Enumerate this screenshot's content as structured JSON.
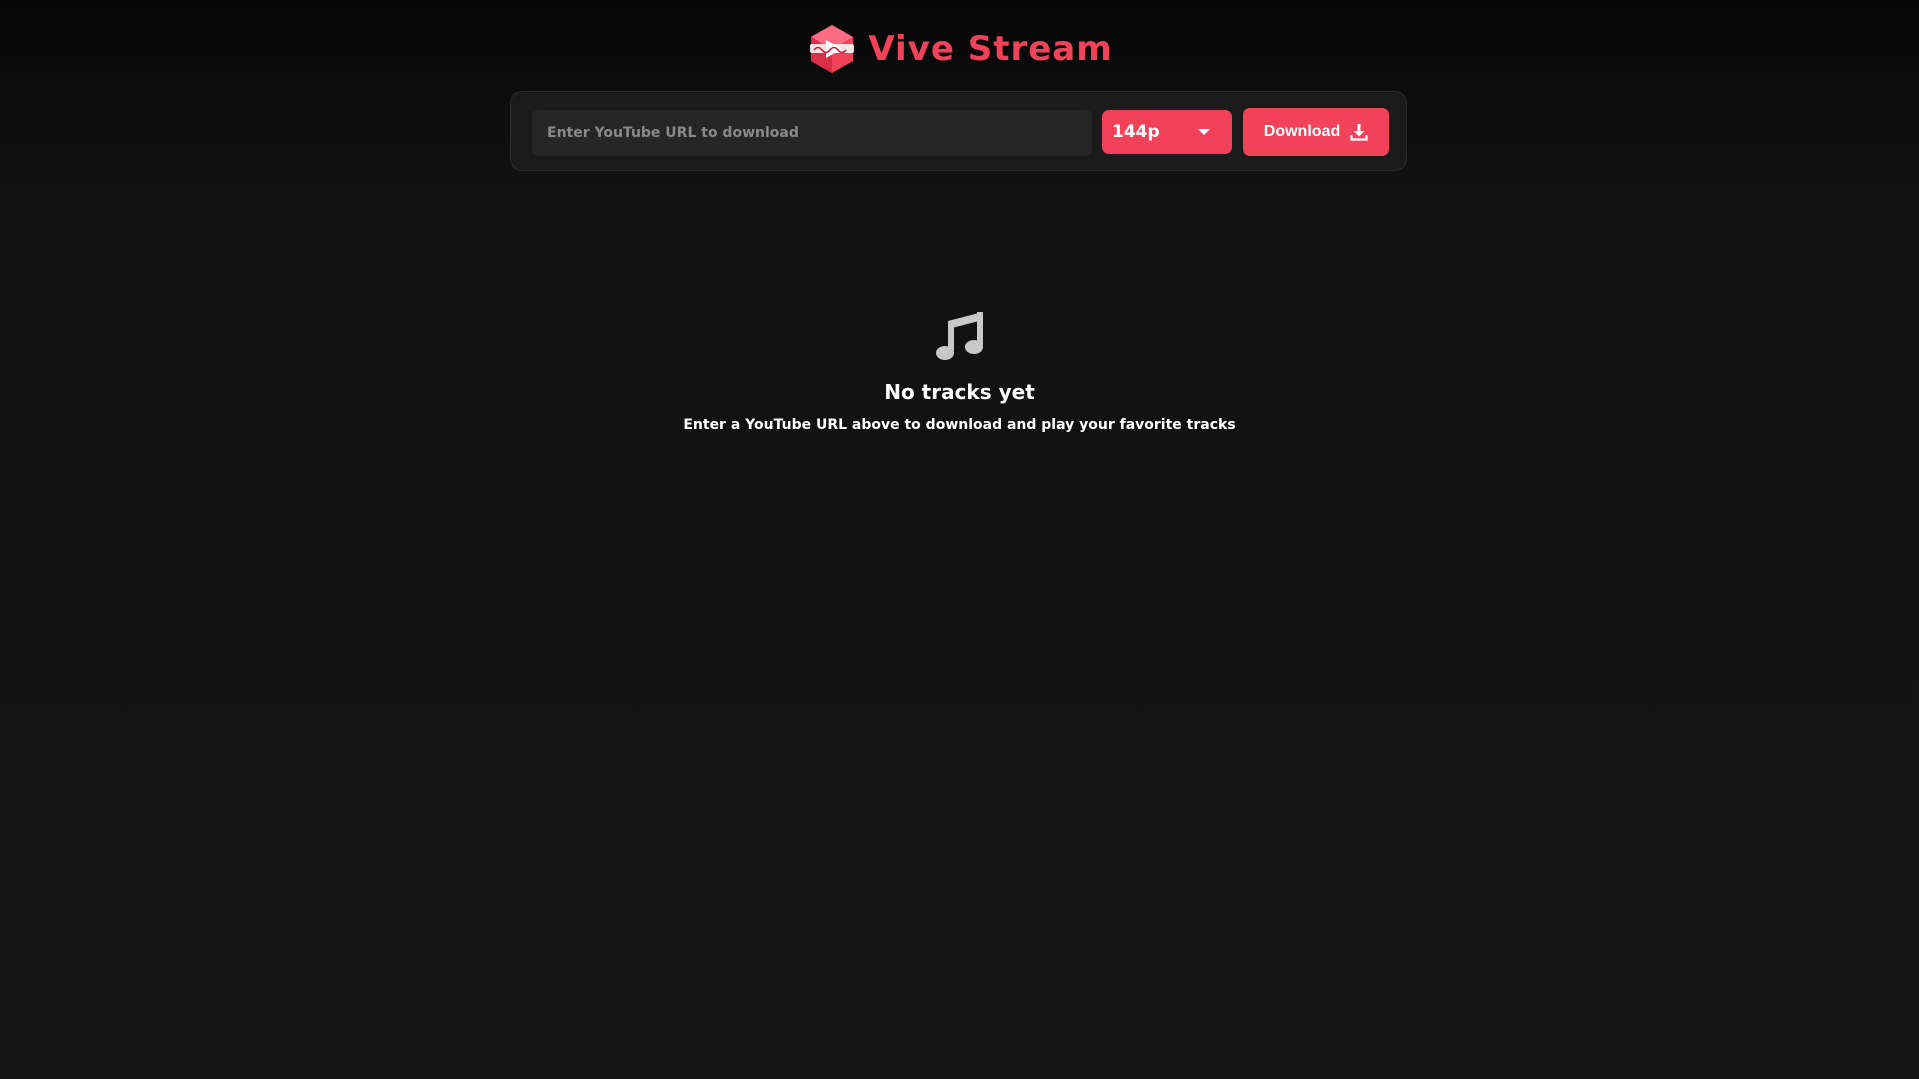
{
  "brand": {
    "name": "Vive Stream",
    "logo_icon": "vive-stream-logo-icon",
    "accent_color": "#f2425a"
  },
  "download_bar": {
    "url_input": {
      "value": "",
      "placeholder": "Enter YouTube URL to download"
    },
    "quality_select": {
      "selected": "144p",
      "icon": "caret-down-icon"
    },
    "download_button": {
      "label": "Download",
      "icon": "download-icon"
    }
  },
  "empty_state": {
    "icon": "music-note-icon",
    "title": "No tracks yet",
    "subtitle": "Enter a YouTube URL above to download and play your favorite tracks"
  }
}
